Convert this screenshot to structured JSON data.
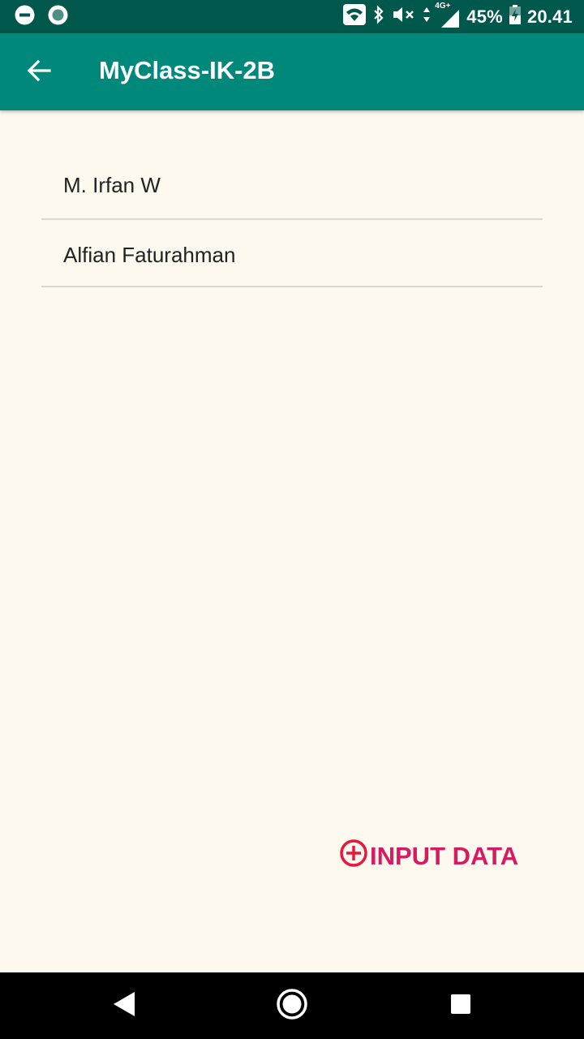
{
  "status_bar": {
    "battery_percent": "45%",
    "time": "20.41",
    "network_label": "4G+",
    "icons": [
      "dnd-icon",
      "record-icon",
      "wifi-icon",
      "bluetooth-icon",
      "mute-icon",
      "data-arrows-icon",
      "signal-icon",
      "battery-icon"
    ]
  },
  "app_bar": {
    "title": "MyClass-IK-2B",
    "back_icon": "arrow-back-icon",
    "color": "#00897b"
  },
  "list": {
    "items": [
      {
        "label": "M. Irfan W"
      },
      {
        "label": "Alfian Faturahman"
      }
    ]
  },
  "input_button": {
    "label": "INPUT DATA",
    "icon": "add-circle-icon",
    "color": "#d81b60"
  },
  "nav_bar": {
    "icons": [
      "nav-back-icon",
      "nav-home-icon",
      "nav-recents-icon"
    ]
  }
}
